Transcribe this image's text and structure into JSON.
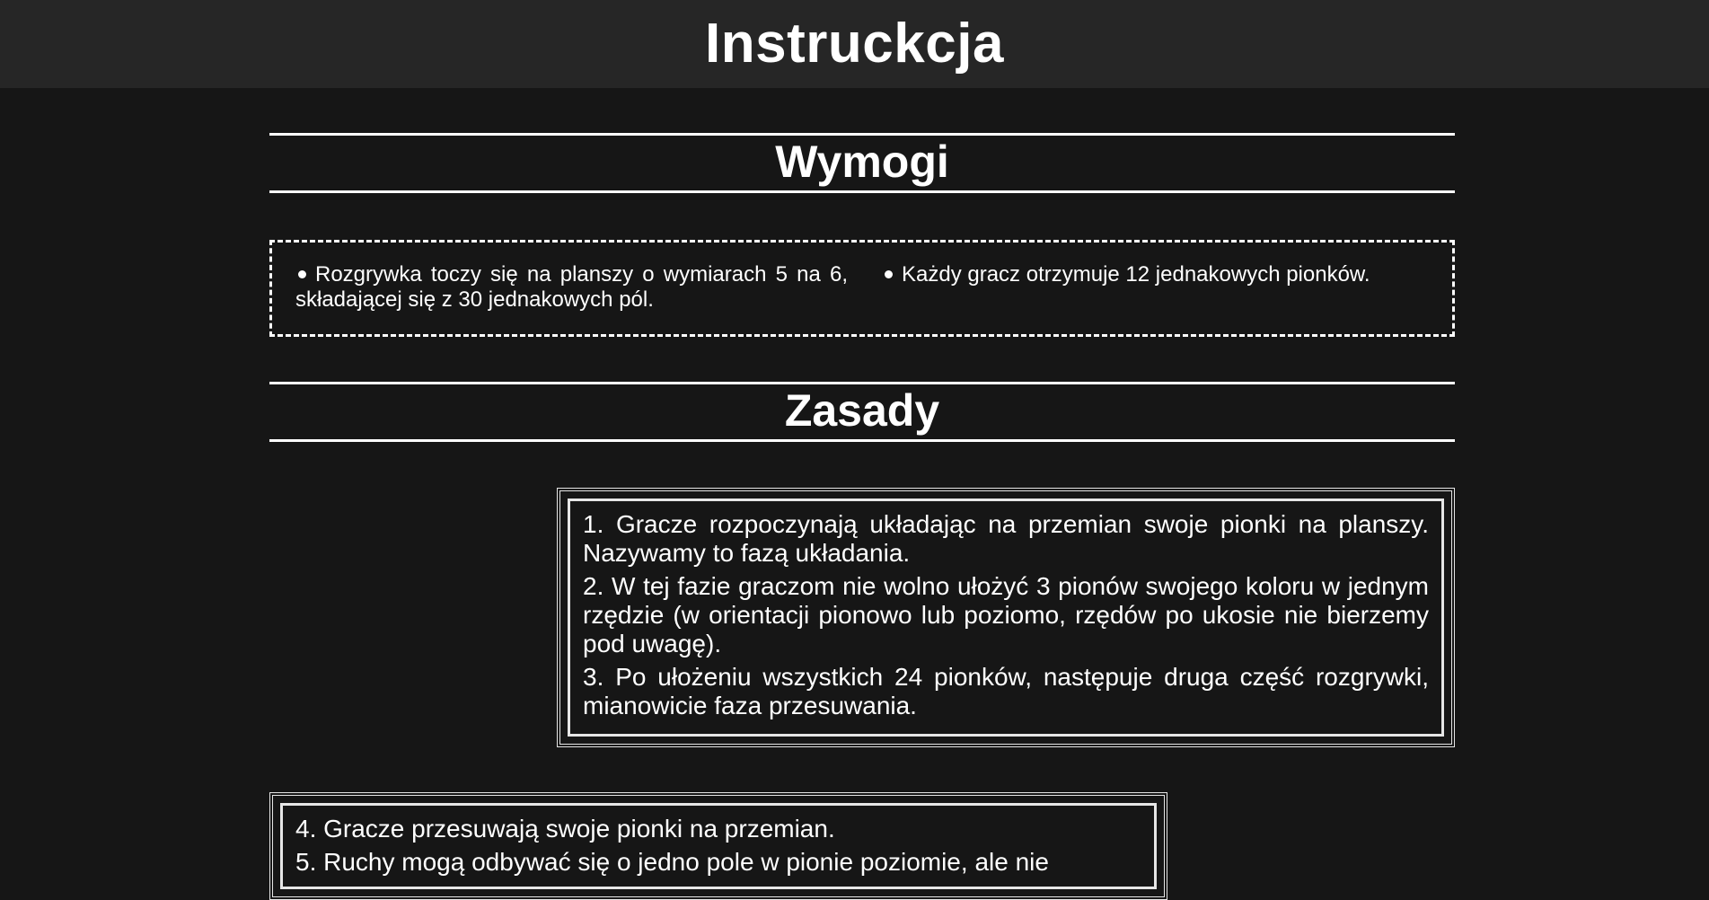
{
  "header": {
    "title": "Instruckcja"
  },
  "sections": {
    "requirements": {
      "title": "Wymogi",
      "items": [
        "Rozgrywka toczy się na planszy o wymiarach 5 na 6, składającej się z 30 jednakowych pól.",
        "Każdy gracz otrzymuje 12 jednakowych pionków."
      ]
    },
    "rules": {
      "title": "Zasady",
      "group_a": [
        "1. Gracze rozpoczynają układając na przemian swoje pionki na planszy. Nazywamy to fazą układania.",
        "2. W tej fazie graczom nie wolno ułożyć 3 pionów swojego koloru w jednym rzędzie (w orientacji pionowo lub poziomo, rzędów po ukosie nie bierzemy pod uwagę).",
        "3. Po ułożeniu wszystkich 24 pionków, następuje druga część rozgrywki, mianowicie faza przesuwania."
      ],
      "group_b": [
        "4. Gracze przesuwają swoje pionki na przemian.",
        "5. Ruchy mogą odbywać się o jedno pole w pionie poziomie, ale nie"
      ]
    }
  },
  "colors": {
    "background": "#161616",
    "header_bg": "#262626",
    "text": "#ffffff"
  }
}
